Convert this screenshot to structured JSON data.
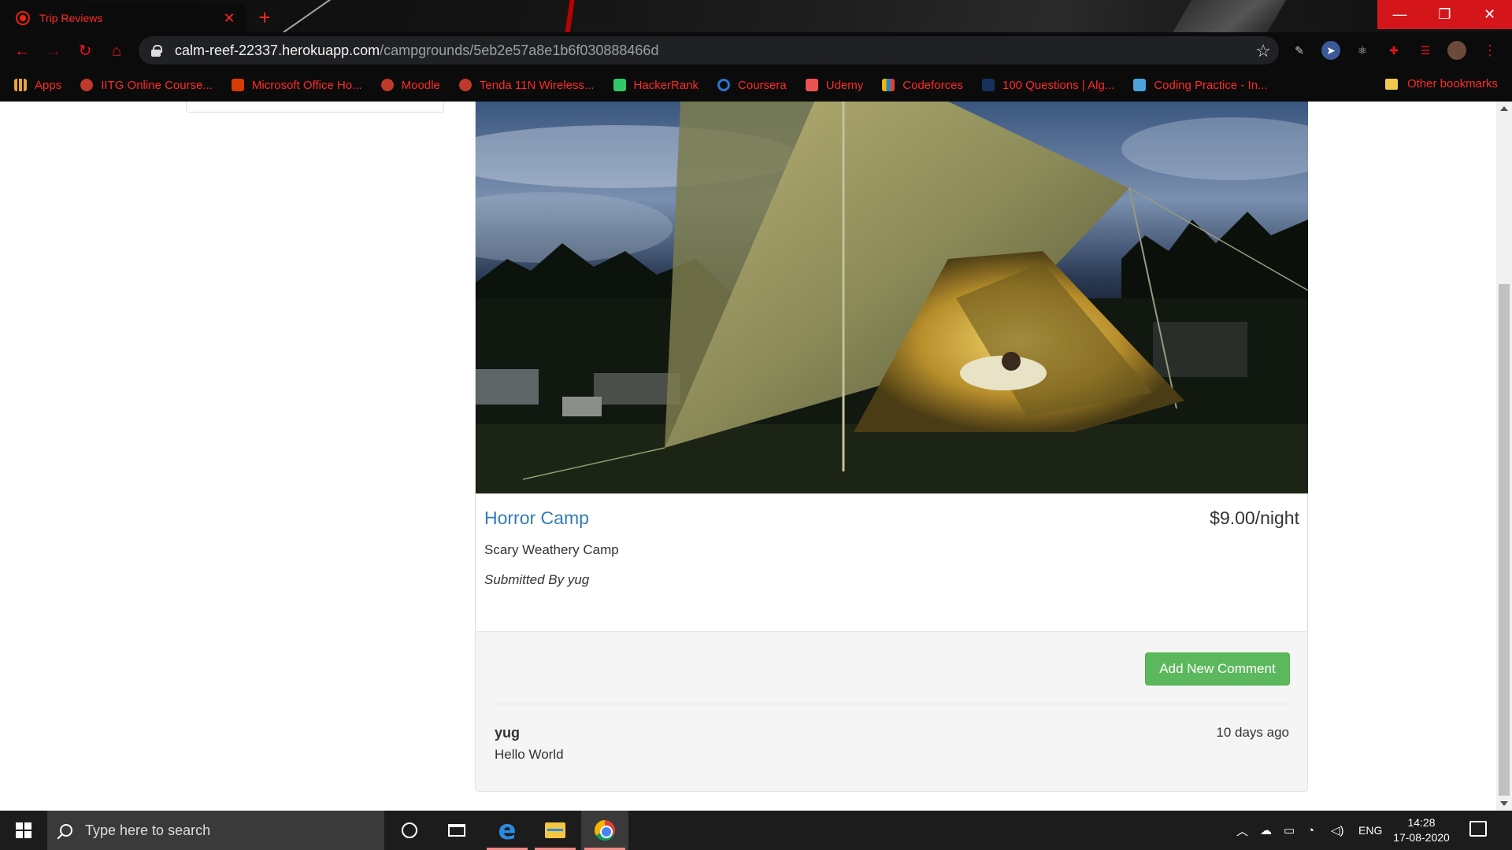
{
  "browser": {
    "tab_title": "Trip Reviews",
    "tab_close": "✕",
    "new_tab": "+",
    "url_host": "calm-reef-22337.herokuapp.com",
    "url_path": "/campgrounds/5eb2e57a8e1b6f030888466d",
    "window_controls": {
      "minimize": "—",
      "maximize": "❐",
      "close": "✕"
    },
    "bookmarks": [
      {
        "label": "Apps",
        "icon": "apps-grid-icon",
        "color": "#e8a33c"
      },
      {
        "label": "IITG Online Course...",
        "icon": "iitg-icon",
        "color": "#c0392b"
      },
      {
        "label": "Microsoft Office Ho...",
        "icon": "office-icon",
        "color": "#d83b01"
      },
      {
        "label": "Moodle",
        "icon": "moodle-icon",
        "color": "#c0392b"
      },
      {
        "label": "Tenda 11N Wireless...",
        "icon": "tenda-icon",
        "color": "#c0392b"
      },
      {
        "label": "HackerRank",
        "icon": "hackerrank-icon",
        "color": "#2ec866"
      },
      {
        "label": "Coursera",
        "icon": "coursera-icon",
        "color": "#2a73cc"
      },
      {
        "label": "Udemy",
        "icon": "udemy-icon",
        "color": "#ec5252"
      },
      {
        "label": "Codeforces",
        "icon": "codeforces-icon",
        "color": "#1f8acb"
      },
      {
        "label": "100 Questions | Alg...",
        "icon": "algo-icon",
        "color": "#16325c"
      },
      {
        "label": "Coding Practice - In...",
        "icon": "interviewbit-icon",
        "color": "#4aa3df"
      }
    ],
    "other_bookmarks": "Other bookmarks"
  },
  "campground": {
    "name": "Horror Camp",
    "price": "$9.00/night",
    "description": "Scary Weathery Camp",
    "submitted_by": "Submitted By yug"
  },
  "comments": {
    "add_button": "Add New Comment",
    "items": [
      {
        "author": "yug",
        "time": "10 days ago",
        "text": "Hello World"
      }
    ]
  },
  "taskbar": {
    "search_placeholder": "Type here to search",
    "language": "ENG",
    "time": "14:28",
    "date": "17-08-2020"
  },
  "colors": {
    "link": "#337ab7",
    "success": "#5cb85c",
    "chrome_accent": "#ff2a2a"
  }
}
